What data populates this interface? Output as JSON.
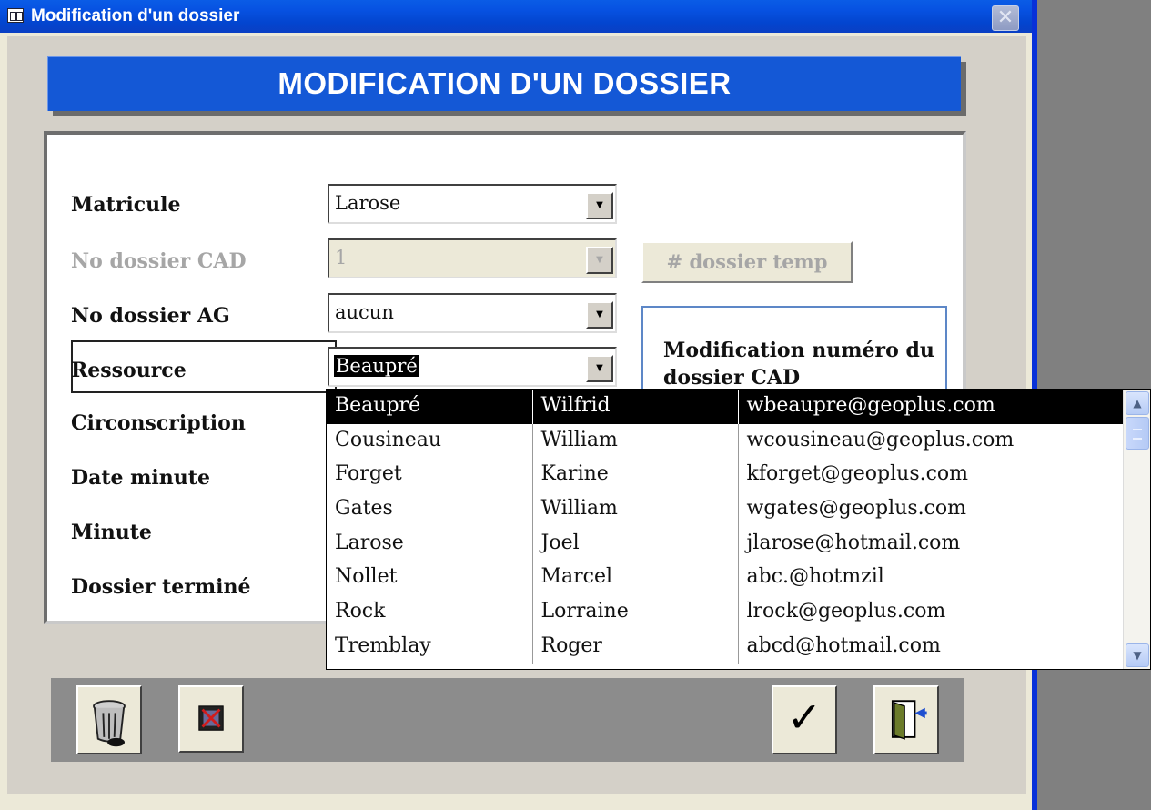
{
  "window": {
    "title": "Modification d'un dossier",
    "close_glyph": "✕"
  },
  "banner": {
    "title": "MODIFICATION D'UN DOSSIER"
  },
  "form": {
    "labels": {
      "matricule": "Matricule",
      "no_dossier_cad": "No dossier CAD",
      "no_dossier_ag": "No dossier AG",
      "ressource": "Ressource",
      "circonscription": "Circonscription",
      "date_minute": "Date minute",
      "minute": "Minute",
      "dossier_termine": "Dossier terminé"
    },
    "fields": {
      "matricule": "Larose",
      "no_dossier_cad": "1",
      "no_dossier_ag": "aucun",
      "ressource": "Beaupré"
    },
    "temp_button": "# dossier temp",
    "cad_box_text": "Modification numéro du dossier CAD"
  },
  "dropdown": {
    "rows": [
      {
        "last": "Beaupré",
        "first": "Wilfrid",
        "email": "wbeaupre@geoplus.com",
        "selected": true
      },
      {
        "last": "Cousineau",
        "first": "William",
        "email": "wcousineau@geoplus.com"
      },
      {
        "last": "Forget",
        "first": "Karine",
        "email": "kforget@geoplus.com"
      },
      {
        "last": "Gates",
        "first": "William",
        "email": "wgates@geoplus.com"
      },
      {
        "last": "Larose",
        "first": "Joel",
        "email": "jlarose@hotmail.com"
      },
      {
        "last": "Nollet",
        "first": "Marcel",
        "email": "abc.@hotmzil"
      },
      {
        "last": "Rock",
        "first": "Lorraine",
        "email": "lrock@geoplus.com"
      },
      {
        "last": "Tremblay",
        "first": "Roger",
        "email": "abcd@hotmail.com"
      }
    ]
  },
  "toolbar": {
    "icons": [
      "trash-icon",
      "delete-record-icon",
      "checkmark-icon",
      "exit-door-icon"
    ],
    "checkmark_glyph": "✓"
  },
  "colors": {
    "titlebar": "#0752e2",
    "banner": "#1458d6",
    "window_bg": "#d4d0c8",
    "desktop": "#808080"
  }
}
